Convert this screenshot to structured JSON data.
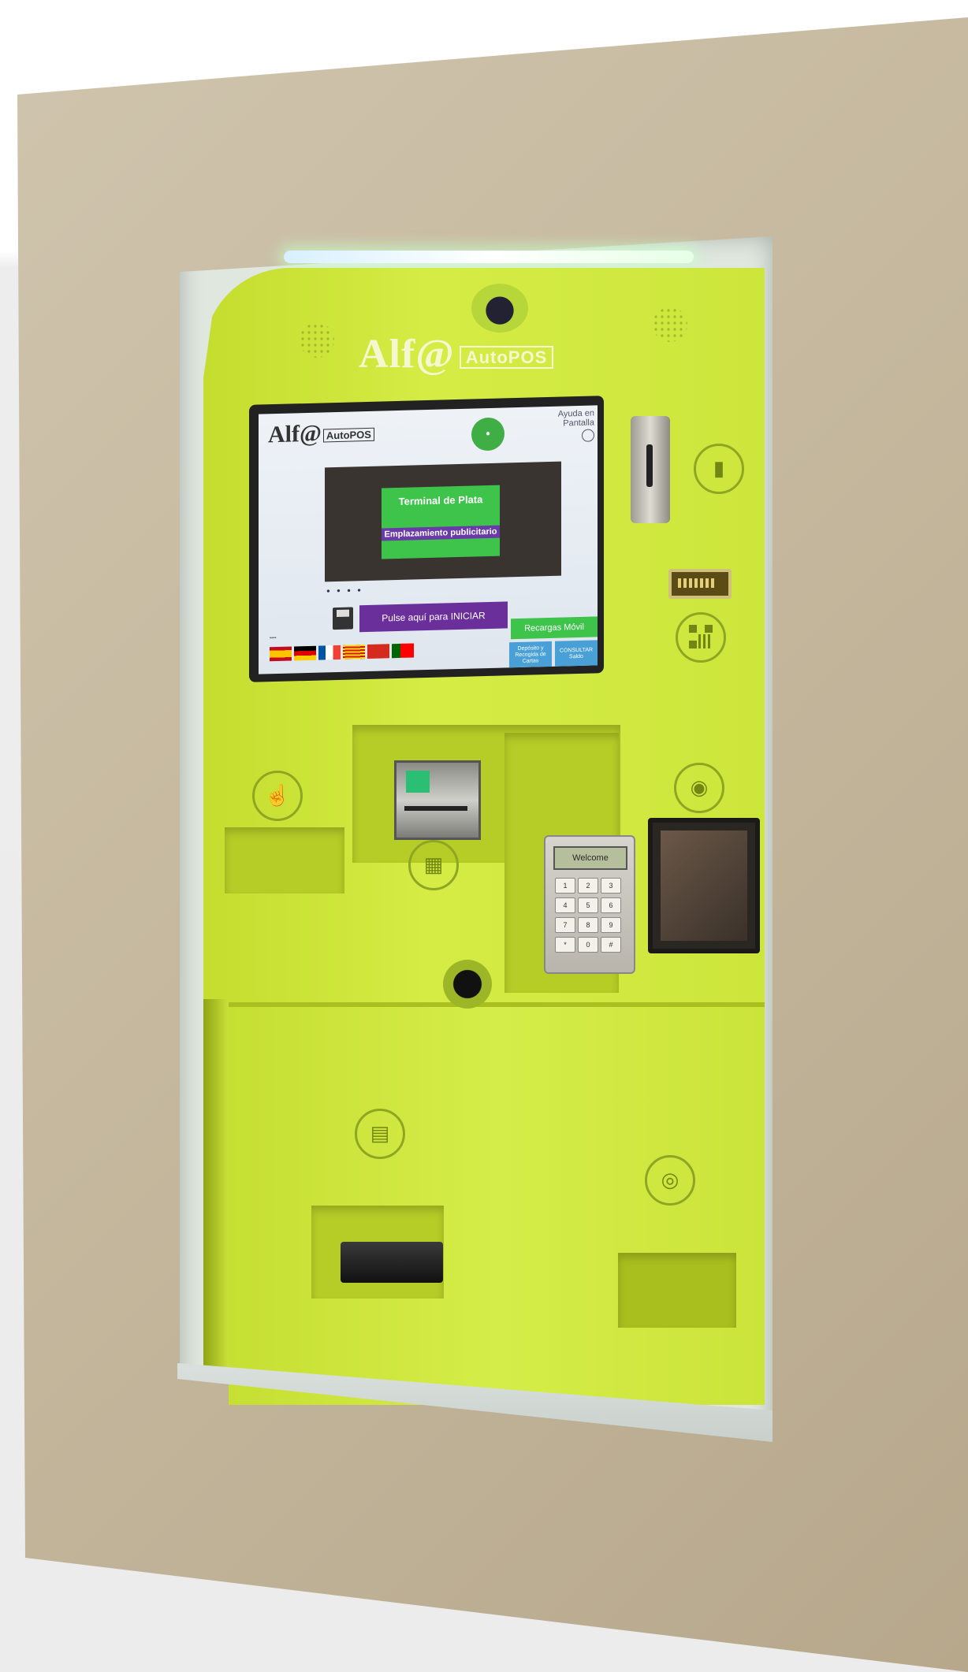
{
  "brand": {
    "name": "Alf@",
    "product": "AutoPOS"
  },
  "screen": {
    "logo_main": "Alf@",
    "logo_sub": "AutoPOS",
    "help_text": "Ayuda en Pantalla",
    "ad_title": "Terminal de Plata",
    "ad_subtitle": "Emplazamiento publicitario",
    "start_button": "Pulse aquí para INICIAR",
    "recharge_button": "Recargas Móvil",
    "side_button_1": "Depósito y Recogida de Cartas",
    "side_button_2": "CONSULTAR Saldo",
    "flags": [
      "spain-flag",
      "germany-flag",
      "france-flag",
      "catalonia-flag",
      "basque-flag",
      "portugal-flag"
    ]
  },
  "pinpad": {
    "display": "Welcome",
    "keys": [
      "1",
      "2",
      "3",
      "4",
      "5",
      "6",
      "7",
      "8",
      "9",
      "*",
      "0",
      "#"
    ]
  },
  "colors": {
    "kiosk_body": "#d2ea42",
    "frame": "#c5b89e",
    "screen_start": "#6b2f9c",
    "screen_accent": "#3ec44a"
  },
  "icons": {
    "card": "card-insert-icon",
    "qr": "qr-code-icon",
    "hand": "hand-touch-icon",
    "banknote": "banknote-icon",
    "contactless": "contactless-icon",
    "receipt": "receipt-icon",
    "coins": "coins-icon"
  }
}
